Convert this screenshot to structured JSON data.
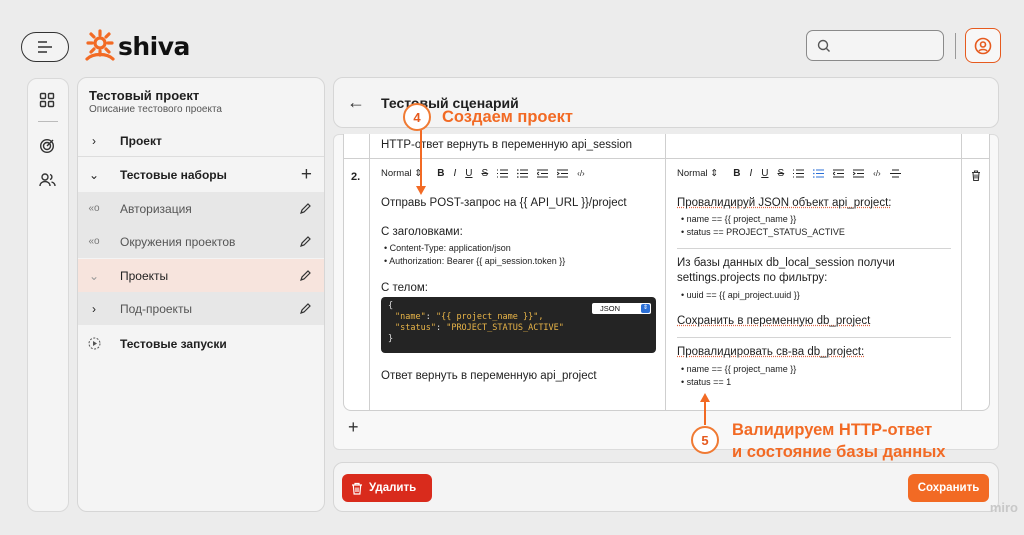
{
  "header": {
    "logo_text": "shiva",
    "search_placeholder": ""
  },
  "project": {
    "title": "Тестовый проект",
    "description": "Описание тестового проекта",
    "tree": [
      {
        "label": "Проект",
        "chevron": "›"
      },
      {
        "label": "Тестовые наборы",
        "chevron": "⌄",
        "action": "+"
      },
      {
        "label": "Авторизация",
        "chevron": "«o"
      },
      {
        "label": "Окружения проектов",
        "chevron": "«o"
      },
      {
        "label": "Проекты",
        "chevron": "⌄"
      },
      {
        "label": "Под-проекты",
        "chevron": "›"
      },
      {
        "label": "Тестовые запуски"
      }
    ]
  },
  "scenario": {
    "back": "←",
    "title": "Тестовый сценарий"
  },
  "table": {
    "prev_row_text": "HTTP-ответ вернуть в переменную api_session",
    "row_number": "2.",
    "toolbar": {
      "format": "Normal",
      "format_arrow": "⇕",
      "bold": "B",
      "italic": "I",
      "underline": "U",
      "strike": "S",
      "code": "‹/›"
    },
    "action": {
      "line1": "Отправь POST-запрос на {{ API_URL }}/project",
      "headers_title": "С заголовками:",
      "headers": [
        "Content-Type: application/json",
        "Authorization: Bearer {{ api_session.token }}"
      ],
      "body_title": "С телом:",
      "code_brace_open": "{",
      "code_line1_key": "\"name\"",
      "code_line1_val": "\"{{ project_name }}\",",
      "code_line2_key": "\"status\"",
      "code_line2_val": "\"PROJECT_STATUS_ACTIVE\"",
      "code_brace_close": "}",
      "code_language": "JSON",
      "return_line": "Ответ вернуть в переменную api_project"
    },
    "expected": {
      "block1_title": "Провалидируй JSON объект api_project:",
      "block1_items": [
        "name == {{ project_name }}",
        "status == PROJECT_STATUS_ACTIVE"
      ],
      "block2_line1": "Из базы данных db_local_session получи",
      "block2_line2": "settings.projects по фильтру:",
      "block2_items": [
        "uuid == {{ api_project.uuid }}"
      ],
      "block3": "Сохранить в переменную db_project",
      "block4_title": "Провалидировать св-ва db_project:",
      "block4_items": [
        "name == {{ project_name }}",
        "status == 1"
      ]
    },
    "add_row": "+"
  },
  "footer": {
    "delete_label": "Удалить",
    "save_label": "Сохранить"
  },
  "annotations": {
    "badge4": "4",
    "text4": "Создаем проект",
    "badge5": "5",
    "text5_line1": "Валидируем HTTP-ответ",
    "text5_line2": "и состояние базы данных"
  },
  "watermark": "miro",
  "colors": {
    "accent": "#f26a24",
    "danger": "#d92b1c",
    "active_row": "#f7e4dd"
  }
}
